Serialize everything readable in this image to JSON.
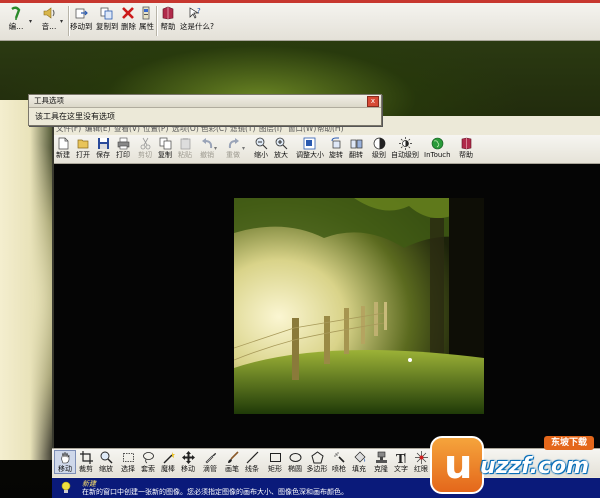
{
  "top_toolbar": {
    "buttons": [
      {
        "label": "编..."
      },
      {
        "label": "音..."
      },
      {
        "label": "移动到"
      },
      {
        "label": "复制到"
      },
      {
        "label": "删除"
      },
      {
        "label": "属性"
      },
      {
        "label": "帮助"
      },
      {
        "label": "这是什么?"
      }
    ]
  },
  "tool_options": {
    "title": "工具选项",
    "message": "该工具在这里没有选项",
    "close_glyph": "x"
  },
  "menubar": {
    "items": [
      "文件(F)",
      "编辑(E)",
      "查看(V)",
      "位置(P)",
      "选项(O)",
      "色彩(C)",
      "滤镜(T)",
      "图层(I)",
      "窗口(W)",
      "帮助(H)"
    ]
  },
  "app_toolbar": {
    "buttons": [
      {
        "label": "新建",
        "disabled": false
      },
      {
        "label": "打开",
        "disabled": false
      },
      {
        "label": "保存",
        "disabled": false
      },
      {
        "label": "打印",
        "disabled": false
      },
      {
        "label": "剪切",
        "disabled": true
      },
      {
        "label": "复制",
        "disabled": false
      },
      {
        "label": "粘贴",
        "disabled": true
      },
      {
        "label": "撤销",
        "disabled": true
      },
      {
        "label": "重做",
        "disabled": true
      },
      {
        "label": "缩小",
        "disabled": false
      },
      {
        "label": "放大",
        "disabled": false
      },
      {
        "label": "调整大小",
        "disabled": false
      },
      {
        "label": "旋转",
        "disabled": false
      },
      {
        "label": "翻转",
        "disabled": false
      },
      {
        "label": "级别",
        "disabled": false
      },
      {
        "label": "自动级别",
        "disabled": false
      },
      {
        "label": "InTouch",
        "disabled": false
      },
      {
        "label": "帮助",
        "disabled": false
      }
    ]
  },
  "bottom_tools": {
    "tools": [
      {
        "label": "移动",
        "selected": true
      },
      {
        "label": "裁剪",
        "selected": false
      },
      {
        "label": "缩放",
        "selected": false
      },
      {
        "label": "选择",
        "selected": false
      },
      {
        "label": "套索",
        "selected": false
      },
      {
        "label": "魔棒",
        "selected": false
      },
      {
        "label": "移动",
        "selected": false
      },
      {
        "label": "滴管",
        "selected": false
      },
      {
        "label": "画笔",
        "selected": false
      },
      {
        "label": "线条",
        "selected": false
      },
      {
        "label": "矩形",
        "selected": false
      },
      {
        "label": "椭圆",
        "selected": false
      },
      {
        "label": "多边形",
        "selected": false
      },
      {
        "label": "喷枪",
        "selected": false
      },
      {
        "label": "填充",
        "selected": false
      },
      {
        "label": "克隆",
        "selected": false
      },
      {
        "label": "文字",
        "selected": false
      },
      {
        "label": "红眼",
        "selected": false
      }
    ]
  },
  "statusbar": {
    "title": "新建",
    "text": "在新的窗口中创建一张新的图像。您必须指定图像的画布大小、图像色深和画布颜色。"
  },
  "watermark": {
    "letter": "u",
    "brand": "uzzf.com",
    "badge": "东坡下载"
  },
  "colors": {
    "status_bg": "#0a1a7a",
    "status_title": "#ffe36b",
    "watermark_orange": "#e4671b",
    "watermark_blue": "#0a6fb8"
  }
}
